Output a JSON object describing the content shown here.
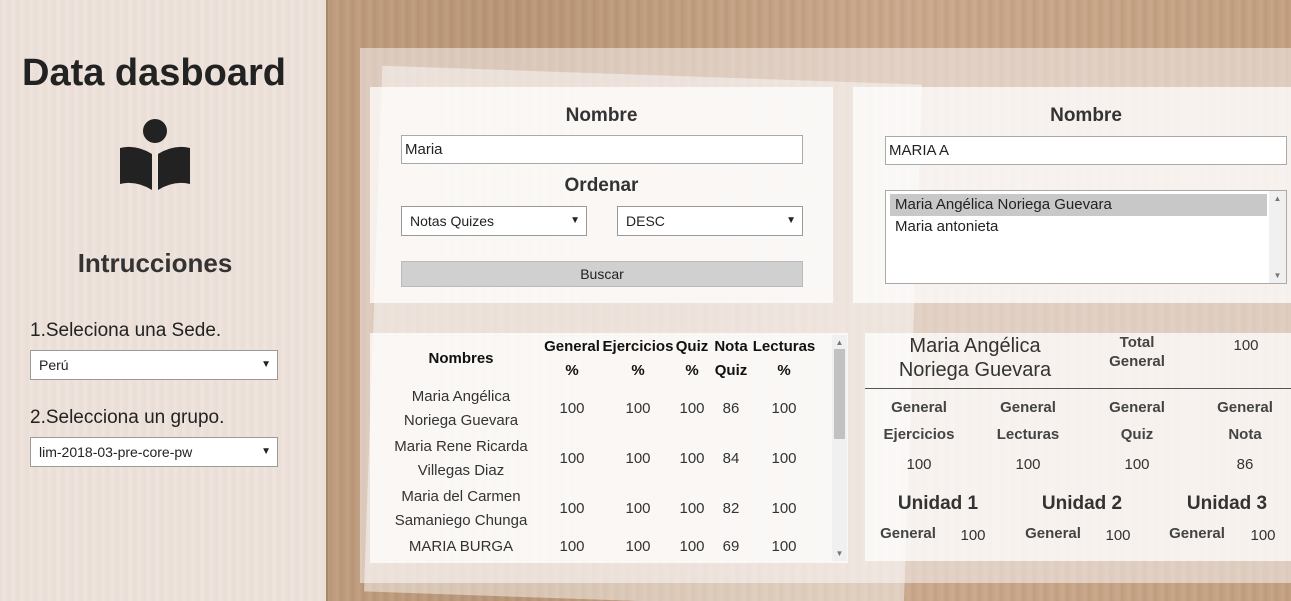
{
  "sidebar": {
    "title": "Data dasboard",
    "icon": "reader-icon",
    "instructions_title": "Intrucciones",
    "step1_label": "1.Seleciona una Sede.",
    "sede_selected": "Perú",
    "step2_label": "2.Selecciona un grupo.",
    "group_selected": "lim-2018-03-pre-core-pw"
  },
  "search_panel": {
    "name_label": "Nombre",
    "name_value": "Maria",
    "order_label": "Ordenar",
    "order_field": "Notas Quizes",
    "order_direction": "DESC",
    "search_button": "Buscar"
  },
  "name_panel": {
    "name_label": "Nombre",
    "name_value": "MARIA A",
    "results": [
      {
        "label": "Maria Angélica Noriega Guevara",
        "selected": true
      },
      {
        "label": "Maria antonieta",
        "selected": false
      }
    ]
  },
  "table": {
    "headers": {
      "names": "Nombres",
      "general": "General",
      "general_unit": "%",
      "ejercicios": "Ejercicios",
      "ejercicios_unit": "%",
      "quiz": "Quiz",
      "quiz_unit": "%",
      "nota": "Nota",
      "nota_sub": "Quiz",
      "lecturas": "Lecturas",
      "lecturas_unit": "%"
    },
    "rows": [
      {
        "name1": "Maria Angélica",
        "name2": "Noriega Guevara",
        "general": "100",
        "ejercicios": "100",
        "quiz": "100",
        "nota": "86",
        "lecturas": "100"
      },
      {
        "name1": "Maria Rene Ricarda",
        "name2": "Villegas Diaz",
        "general": "100",
        "ejercicios": "100",
        "quiz": "100",
        "nota": "84",
        "lecturas": "100"
      },
      {
        "name1": "Maria del Carmen",
        "name2": "Samaniego Chunga",
        "general": "100",
        "ejercicios": "100",
        "quiz": "100",
        "nota": "82",
        "lecturas": "100"
      },
      {
        "name1": "MARIA BURGA",
        "name2": "",
        "general": "100",
        "ejercicios": "100",
        "quiz": "100",
        "nota": "69",
        "lecturas": "100"
      }
    ]
  },
  "summary": {
    "student_name_1": "Maria Angélica",
    "student_name_2": "Noriega Guevara",
    "total_label_1": "Total",
    "total_label_2": "General",
    "total_value": "100",
    "metrics": [
      {
        "l1": "General",
        "l2": "Ejercicios",
        "value": "100"
      },
      {
        "l1": "General",
        "l2": "Lecturas",
        "value": "100"
      },
      {
        "l1": "General",
        "l2": "Quiz",
        "value": "100"
      },
      {
        "l1": "General",
        "l2": "Nota",
        "value": "86"
      }
    ],
    "units": [
      {
        "title": "Unidad 1",
        "label": "General",
        "value": "100"
      },
      {
        "title": "Unidad 2",
        "label": "General",
        "value": "100"
      },
      {
        "title": "Unidad 3",
        "label": "General",
        "value": "100"
      }
    ]
  }
}
